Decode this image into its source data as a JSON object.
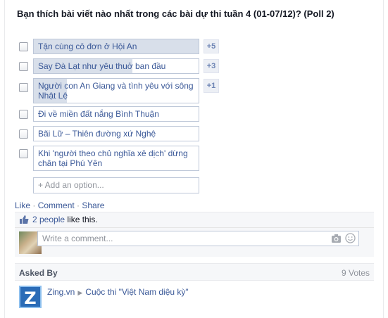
{
  "poll": {
    "title": "Bạn thích bài viết nào nhất trong các bài dự thi tuần 4 (01-07/12)? (Poll 2)",
    "options": [
      {
        "label": "Tận cùng cô đơn ở Hội An",
        "votes": "+5",
        "fill": 1.0
      },
      {
        "label": "Say Đà Lạt như yêu thuở ban đầu",
        "votes": "+3",
        "fill": 0.6
      },
      {
        "label": "Người con An Giang và tình yêu với sông Nhật Lệ",
        "votes": "+1",
        "fill": 0.2
      },
      {
        "label": "Đi về miền đất nắng Bình Thuận",
        "votes": "",
        "fill": 0
      },
      {
        "label": "Bãi Lữ – Thiên đường xứ Nghệ",
        "votes": "",
        "fill": 0
      },
      {
        "label": "Khi 'người theo chủ nghĩa xê dịch' dừng chân tại Phú Yên",
        "votes": "",
        "fill": 0
      }
    ],
    "add_option_placeholder": "+ Add an option..."
  },
  "actions": {
    "like": "Like",
    "sep": " · ",
    "comment": "Comment",
    "share": "Share"
  },
  "likes": {
    "count_text": "2 people",
    "suffix": " like this."
  },
  "comment": {
    "placeholder": "Write a comment..."
  },
  "asked_by": {
    "label": "Asked By",
    "total": "9 Votes",
    "page": "Zing.vn",
    "event": "Cuộc thi \"Việt Nam diệu kỳ\""
  },
  "colors": {
    "link": "#3b5998",
    "fill": "#d8dfea",
    "border": "#bdc7d8"
  }
}
